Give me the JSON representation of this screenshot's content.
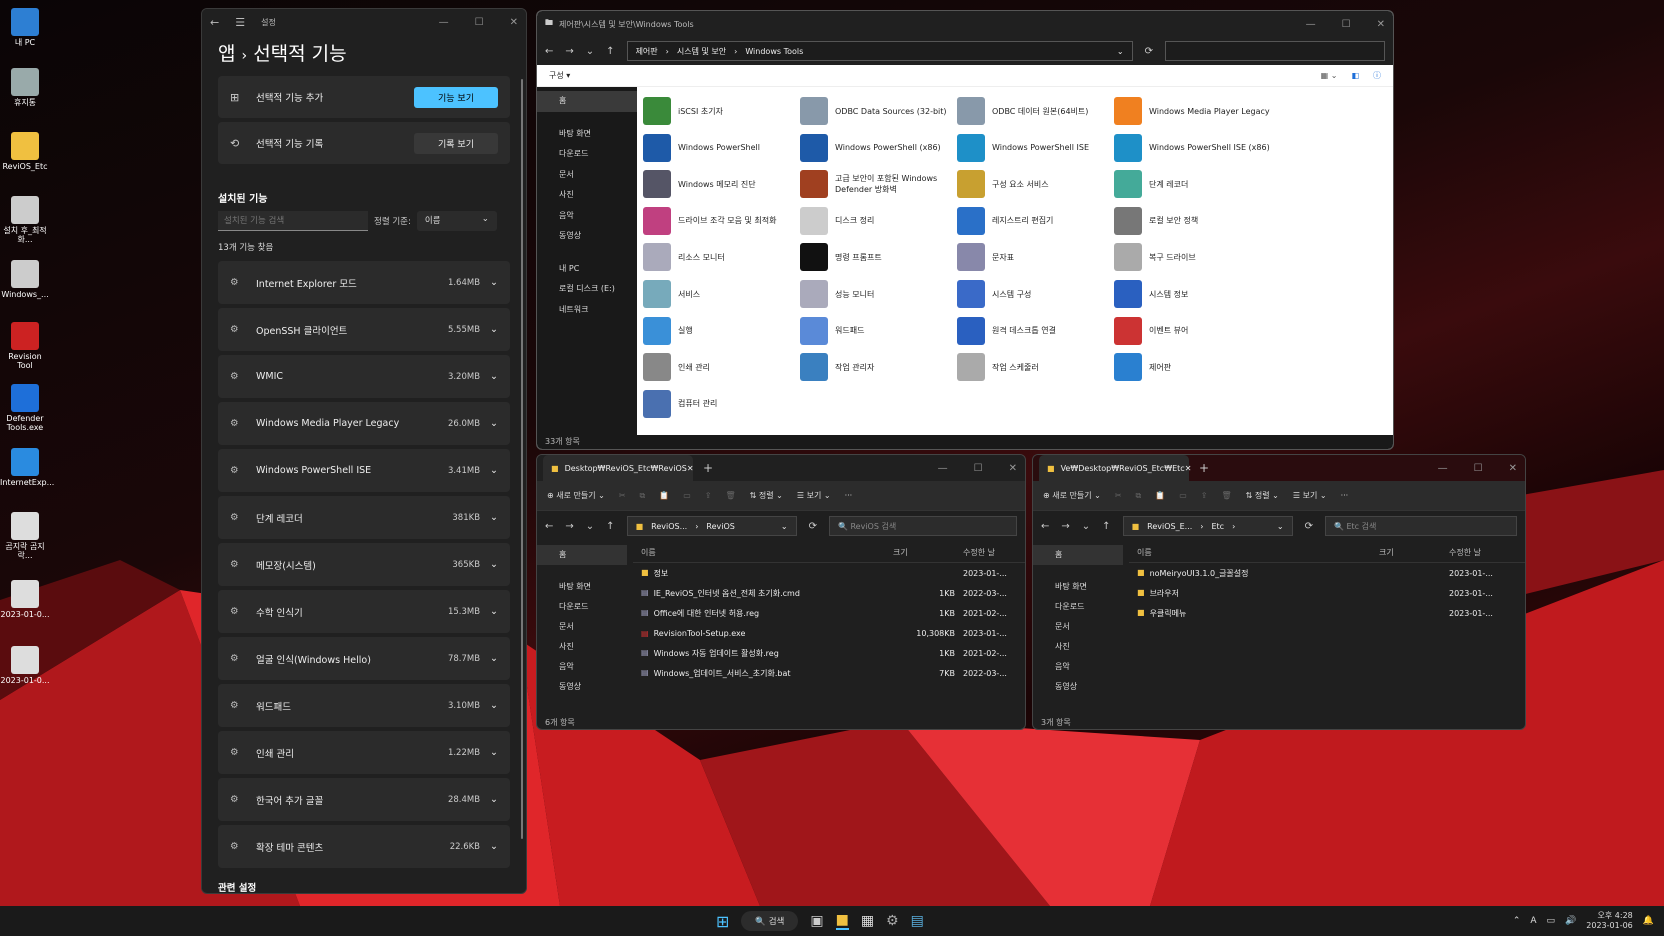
{
  "desktop": {
    "icons": [
      {
        "label": "내 PC",
        "color": "#2d7fd3"
      },
      {
        "label": "휴지통",
        "color": "#9aa"
      },
      {
        "label": "ReviOS_Etc",
        "color": "#f0c040"
      },
      {
        "label": "설치 후_최적화...",
        "color": "#ccc"
      },
      {
        "label": "Windows_...",
        "color": "#ccc"
      },
      {
        "label": "Revision Tool",
        "color": "#c22"
      },
      {
        "label": "Defender Tools.exe",
        "color": "#1e6fd9"
      },
      {
        "label": "InternetExp...",
        "color": "#2a8be0"
      },
      {
        "label": "곰지락 곰지락...",
        "color": "#ddd"
      },
      {
        "label": "2023-01-0...",
        "color": "#ddd"
      },
      {
        "label": "2023-01-0...",
        "color": "#ddd"
      }
    ]
  },
  "settings": {
    "title": "설정",
    "breadcrumb_root": "앱",
    "breadcrumb_sep": "›",
    "page_title": "선택적 기능",
    "add_label": "선택적 기능 추가",
    "add_button": "기능 보기",
    "history_label": "선택적 기능 기록",
    "history_button": "기록 보기",
    "installed_heading": "설치된 기능",
    "search_placeholder": "설치된 기능 검색",
    "sort_label": "정렬 기준:",
    "sort_value": "이름",
    "count_text": "13개 기능 찾음",
    "features": [
      {
        "name": "Internet Explorer 모드",
        "size": "1.64MB"
      },
      {
        "name": "OpenSSH 클라이언트",
        "size": "5.55MB"
      },
      {
        "name": "WMIC",
        "size": "3.20MB"
      },
      {
        "name": "Windows Media Player Legacy",
        "size": "26.0MB"
      },
      {
        "name": "Windows PowerShell ISE",
        "size": "3.41MB"
      },
      {
        "name": "단계 레코더",
        "size": "381KB"
      },
      {
        "name": "메모장(시스템)",
        "size": "365KB"
      },
      {
        "name": "수학 인식기",
        "size": "15.3MB"
      },
      {
        "name": "얼굴 인식(Windows Hello)",
        "size": "78.7MB"
      },
      {
        "name": "워드패드",
        "size": "3.10MB"
      },
      {
        "name": "인쇄 관리",
        "size": "1.22MB"
      },
      {
        "name": "한국어 추가 글꼴",
        "size": "28.4MB"
      },
      {
        "name": "확장 테마 콘텐츠",
        "size": "22.6KB"
      }
    ],
    "related": "관련 설정",
    "accent": "#4cc2ff"
  },
  "tools": {
    "title": "제어판\\시스템 및 보안\\Windows Tools",
    "path": [
      "제어판",
      "시스템 및 보안",
      "Windows Tools"
    ],
    "organize": "구성 ▾",
    "status": "33개 항목",
    "nav": [
      "홈",
      "바탕 화면",
      "다운로드",
      "문서",
      "사진",
      "음악",
      "동영상",
      "내 PC",
      "로컬 디스크 (E:)",
      "네트워크"
    ],
    "items": [
      {
        "label": "iSCSI 초기자",
        "color": "#3a8a3a"
      },
      {
        "label": "ODBC Data Sources (32-bit)",
        "color": "#8899aa"
      },
      {
        "label": "ODBC 데이터 원본(64비트)",
        "color": "#8899aa"
      },
      {
        "label": "Windows Media Player Legacy",
        "color": "#f08020"
      },
      {
        "label": "Windows PowerShell",
        "color": "#1e5aa8"
      },
      {
        "label": "Windows PowerShell (x86)",
        "color": "#1e5aa8"
      },
      {
        "label": "Windows PowerShell ISE",
        "color": "#1e90c8"
      },
      {
        "label": "Windows PowerShell ISE (x86)",
        "color": "#1e90c8"
      },
      {
        "label": "Windows 메모리 진단",
        "color": "#556"
      },
      {
        "label": "고급 보안이 포함된 Windows Defender 방화벽",
        "color": "#a04020"
      },
      {
        "label": "구성 요소 서비스",
        "color": "#c8a030"
      },
      {
        "label": "단계 레코더",
        "color": "#4a9"
      },
      {
        "label": "드라이브 조각 모음 및 최적화",
        "color": "#c04080"
      },
      {
        "label": "디스크 정리",
        "color": "#ccc"
      },
      {
        "label": "레지스트리 편집기",
        "color": "#2a70c8"
      },
      {
        "label": "로컬 보안 정책",
        "color": "#777"
      },
      {
        "label": "리소스 모니터",
        "color": "#aab"
      },
      {
        "label": "명령 프롬프트",
        "color": "#111"
      },
      {
        "label": "문자표",
        "color": "#88a"
      },
      {
        "label": "복구 드라이브",
        "color": "#aaa"
      },
      {
        "label": "서비스",
        "color": "#7ab"
      },
      {
        "label": "성능 모니터",
        "color": "#aab"
      },
      {
        "label": "시스템 구성",
        "color": "#3a6ac8"
      },
      {
        "label": "시스템 정보",
        "color": "#2a60c0"
      },
      {
        "label": "실행",
        "color": "#3a90d8"
      },
      {
        "label": "워드패드",
        "color": "#5a8ad8"
      },
      {
        "label": "원격 데스크톱 연결",
        "color": "#2a60c0"
      },
      {
        "label": "이벤트 뷰어",
        "color": "#c33"
      },
      {
        "label": "인쇄 관리",
        "color": "#888"
      },
      {
        "label": "작업 관리자",
        "color": "#3a80c0"
      },
      {
        "label": "작업 스케줄러",
        "color": "#aaa"
      },
      {
        "label": "제어판",
        "color": "#2a80d0"
      },
      {
        "label": "컴퓨터 관리",
        "color": "#4a70b0"
      }
    ]
  },
  "revios": {
    "tab": "Desktop₩ReviOS_Etc₩ReviOS",
    "path": [
      "ReviOS...",
      "›",
      "ReviOS"
    ],
    "search": "ReviOS 검색",
    "new": "새로 만들기",
    "sort": "정렬",
    "view": "보기",
    "cols": [
      "이름",
      "크기",
      "수정한 날"
    ],
    "rows": [
      {
        "name": "정보",
        "size": "",
        "date": "2023-01-..."
      },
      {
        "name": "IE_ReviOS_인터넷 옵션_전체 초기화.cmd",
        "size": "1KB",
        "date": "2022-03-..."
      },
      {
        "name": "Office에 대한 인터넷 허용.reg",
        "size": "1KB",
        "date": "2021-02-..."
      },
      {
        "name": "RevisionTool-Setup.exe",
        "size": "10,308KB",
        "date": "2023-01-..."
      },
      {
        "name": "Windows 자동 업데이트 활성화.reg",
        "size": "1KB",
        "date": "2021-02-..."
      },
      {
        "name": "Windows_업데이트_서비스_초기화.bat",
        "size": "7KB",
        "date": "2022-03-..."
      }
    ],
    "nav": [
      "홈",
      "바탕 화면",
      "다운로드",
      "문서",
      "사진",
      "음악",
      "동영상"
    ],
    "status": "6개 항목"
  },
  "etc": {
    "tab": "Ve₩Desktop₩ReviOS_Etc₩Etc",
    "path": [
      "ReviOS_E...",
      "›",
      "Etc",
      "›"
    ],
    "search": "Etc 검색",
    "new": "새로 만들기",
    "sort": "정렬",
    "view": "보기",
    "cols": [
      "이름",
      "크기",
      "수정한 날"
    ],
    "rows": [
      {
        "name": "noMeiryoUI3.1.0_글꼴설정",
        "date": "2023-01-..."
      },
      {
        "name": "브라우저",
        "date": "2023-01-..."
      },
      {
        "name": "우클릭메뉴",
        "date": "2023-01-..."
      }
    ],
    "nav": [
      "홈",
      "바탕 화면",
      "다운로드",
      "문서",
      "사진",
      "음악",
      "동영상"
    ],
    "status": "3개 항목"
  },
  "taskbar": {
    "search": "검색",
    "time": "오후 4:28",
    "date": "2023-01-06",
    "lang": "A"
  }
}
